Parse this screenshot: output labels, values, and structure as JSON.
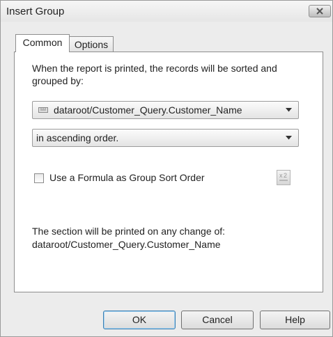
{
  "window": {
    "title": "Insert Group"
  },
  "tabs": [
    {
      "label": "Common",
      "active": true
    },
    {
      "label": "Options",
      "active": false
    }
  ],
  "common": {
    "description": "When the report is printed, the records will be sorted and grouped by:",
    "group_field": {
      "value": "dataroot/Customer_Query.Customer_Name",
      "icon": "database-field-icon"
    },
    "sort_order": {
      "value": "in ascending order."
    },
    "formula_checkbox": {
      "label": "Use a Formula as Group Sort Order",
      "checked": false
    },
    "formula_button_icon": "formula-editor-icon",
    "section_note_line1": "The section will be printed on any change of:",
    "section_note_line2": "dataroot/Customer_Query.Customer_Name"
  },
  "buttons": {
    "ok": "OK",
    "cancel": "Cancel",
    "help": "Help"
  },
  "colors": {
    "default_button_border": "#3c7fb1",
    "dialog_bg": "#ececec"
  }
}
